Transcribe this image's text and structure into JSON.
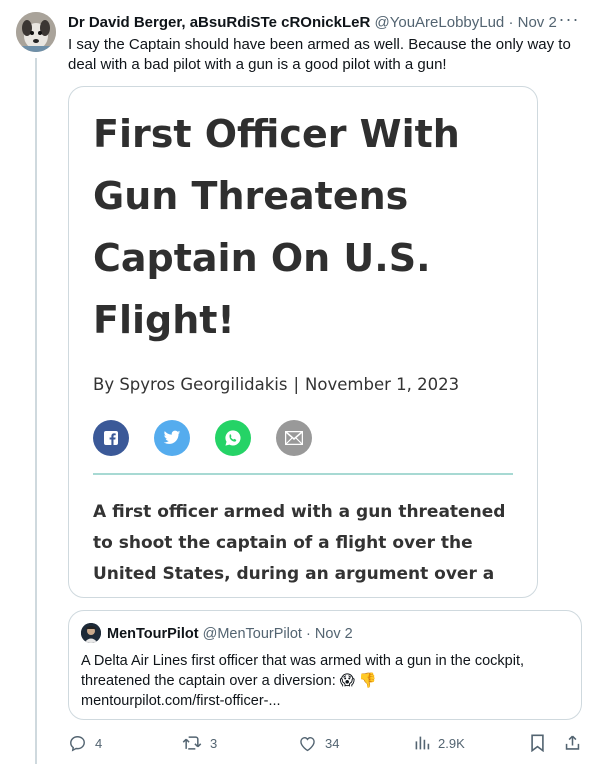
{
  "tweet": {
    "display_name": "Dr David Berger, aBsuRdiSTe cROnickLeR",
    "handle": "@YouAreLobbyLud",
    "dot": "·",
    "date": "Nov 2",
    "more": "···",
    "text": "I say the Captain should have been armed as well. Because the only way to deal with a bad pilot with a gun is a good pilot with a gun!"
  },
  "card": {
    "title": "First Officer With Gun Threatens Captain On U.S. Flight!",
    "author": "By Spyros Georgilidakis",
    "separator": "|",
    "date": "November 1, 2023",
    "share_icons": [
      "facebook-icon",
      "twitter-icon",
      "whatsapp-icon",
      "email-icon"
    ],
    "lede": "A first officer armed with a gun threatened to shoot the captain of a flight over the United States, during an argument over a diversion!"
  },
  "quote": {
    "display_name": "MenTourPilot",
    "handle": "@MenTourPilot",
    "dot": "·",
    "date": "Nov 2",
    "text_line1": "A Delta Air Lines first officer that was armed with a gun in the cockpit, threatened the captain over a diversion: 😱 👎",
    "text_line2": "mentourpilot.com/first-officer-..."
  },
  "actions": {
    "replies": "4",
    "retweets": "3",
    "likes": "34",
    "views": "2.9K"
  },
  "colors": {
    "secondary_text": "#536471",
    "border": "#cfd9de",
    "facebook": "#3b5998",
    "twitter": "#55acee",
    "whatsapp": "#25d366",
    "email": "#999999",
    "accent_rule": "#a7d9d3"
  }
}
